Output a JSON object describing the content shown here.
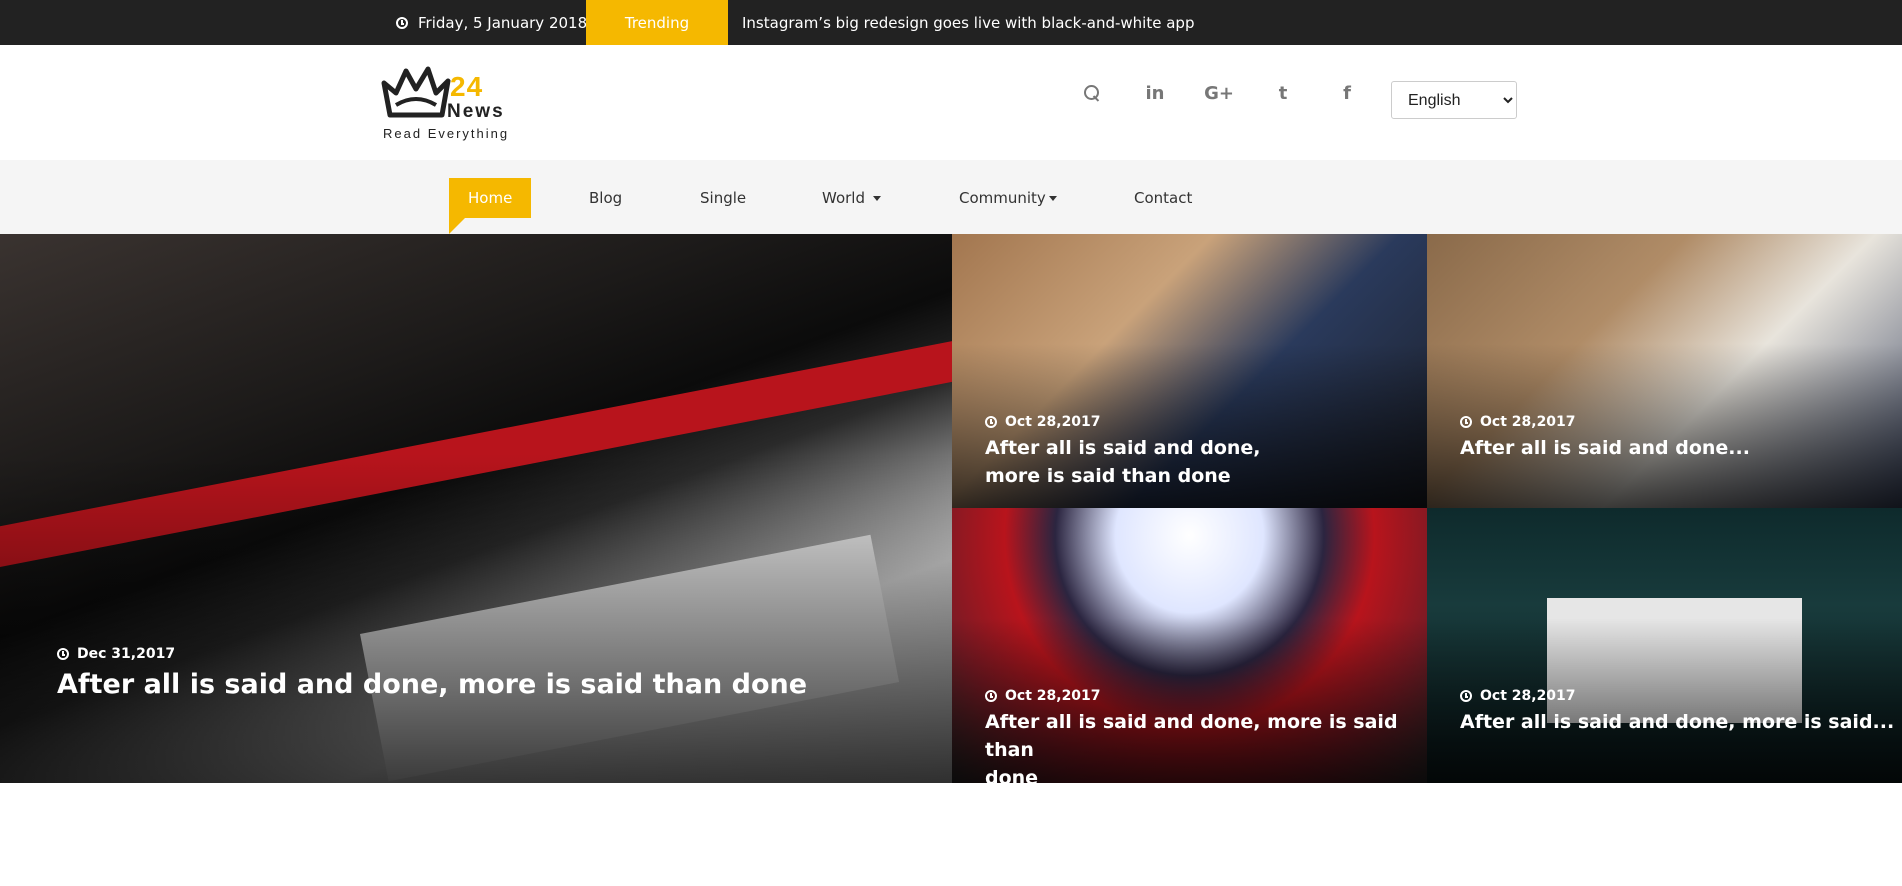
{
  "topbar": {
    "date": "Friday, 5 January 2018",
    "trending_label": "Trending",
    "headline": "Instagram’s big redesign goes live with black-and-white app"
  },
  "brand": {
    "number": "24",
    "name": "News",
    "tagline": "Read Everything",
    "accent": "#f5b800"
  },
  "header": {
    "social_icons": [
      "search-icon",
      "linkedin-icon",
      "google-plus-icon",
      "twitter-icon",
      "facebook-icon"
    ],
    "social_glyphs": {
      "linkedin": "in",
      "google_plus": "G+",
      "twitter": "t",
      "facebook": "f"
    },
    "language": {
      "selected": "English"
    }
  },
  "nav": {
    "items": [
      {
        "label": "Home",
        "active": true
      },
      {
        "label": "Blog"
      },
      {
        "label": "Single"
      },
      {
        "label": "World",
        "dropdown": true
      },
      {
        "label": "Community",
        "dropdown": true
      },
      {
        "label": "Contact"
      }
    ]
  },
  "featured": {
    "main": {
      "date": "Dec 31,2017",
      "title": "After all is said and done, more is said than done"
    },
    "cards": [
      {
        "date": "Oct 28,2017",
        "title_line1": "After all is said and done,",
        "title_line2": "more is said than done"
      },
      {
        "date": "Oct 28,2017",
        "title": "After all is said and done..."
      },
      {
        "date": "Oct 28,2017",
        "title_line1": "After all is said and done, more is said than",
        "title_line2": "done"
      },
      {
        "date": "Oct 28,2017",
        "title": "After all is said and done, more is said..."
      }
    ]
  }
}
